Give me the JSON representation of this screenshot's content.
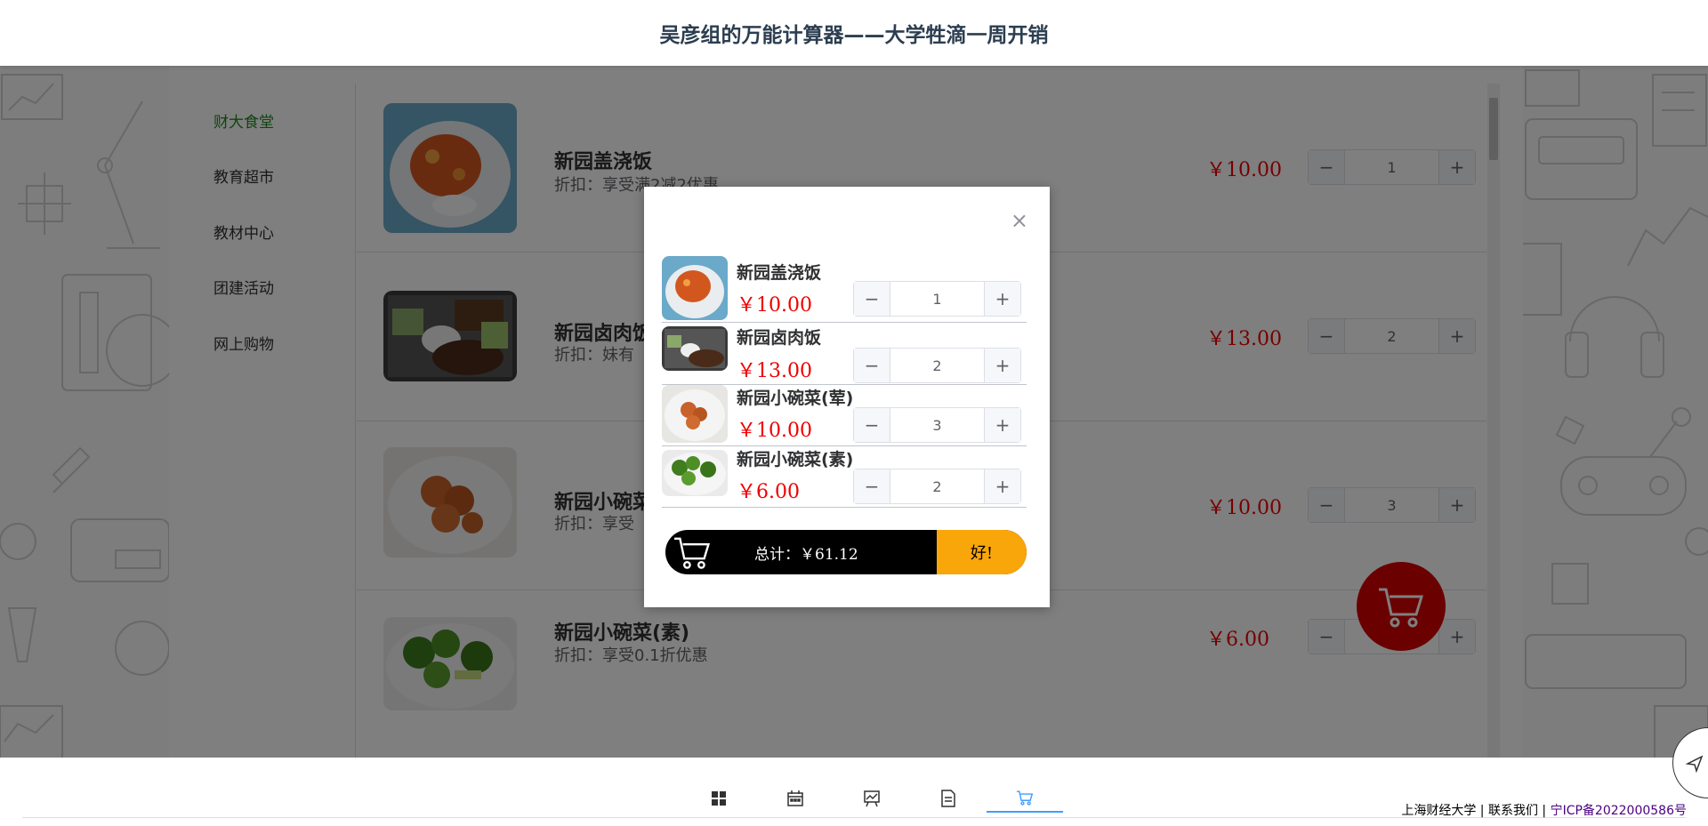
{
  "header": {
    "title": "吴彦组的万能计算器——大学牲滴一周开销"
  },
  "sidebar": {
    "items": [
      {
        "label": "财大食堂",
        "active": true
      },
      {
        "label": "教育超市"
      },
      {
        "label": "教材中心"
      },
      {
        "label": "团建活动"
      },
      {
        "label": "网上购物"
      }
    ]
  },
  "products": [
    {
      "name": "新园盖浇饭",
      "discount": "折扣：享受满2减2优惠",
      "price": "￥10.00",
      "qty": "1",
      "image_icon": "rice-dish-image"
    },
    {
      "name": "新园卤肉饭",
      "discount": "折扣：妹有",
      "price": "￥13.00",
      "qty": "2",
      "image_icon": "braised-pork-image"
    },
    {
      "name": "新园小碗菜(荤)",
      "discount": "折扣：享受",
      "price": "￥10.00",
      "qty": "3",
      "image_icon": "meat-dish-image"
    },
    {
      "name": "新园小碗菜(素)",
      "discount": "折扣：享受0.1折优惠",
      "price": "￥6.00",
      "qty": "2",
      "image_icon": "broccoli-image"
    }
  ],
  "cart_dialog": {
    "items": [
      {
        "name": "新园盖浇饭",
        "price": "￥10.00",
        "qty": "1"
      },
      {
        "name": "新园卤肉饭",
        "price": "￥13.00",
        "qty": "2"
      },
      {
        "name": "新园小碗菜(荤)",
        "price": "￥10.00",
        "qty": "3"
      },
      {
        "name": "新园小碗菜(素)",
        "price": "￥6.00",
        "qty": "2"
      }
    ],
    "total": "总计：￥61.12",
    "ok_label": "好!",
    "close_icon": "close-icon"
  },
  "footer": {
    "tabs": [
      {
        "icon": "grid-icon"
      },
      {
        "icon": "calendar-icon"
      },
      {
        "icon": "chart-icon"
      },
      {
        "icon": "document-icon"
      },
      {
        "icon": "cart-icon",
        "active": true
      }
    ],
    "school": "上海财经大学",
    "sep": " | ",
    "contact": "联系我们",
    "icp": "宁ICP备2022000586号"
  },
  "colors": {
    "price": "#ee0000",
    "active_nav": "#1c8b1c",
    "fab": "#d40000",
    "ok": "#f9a60b",
    "tab_active": "#409eff"
  }
}
